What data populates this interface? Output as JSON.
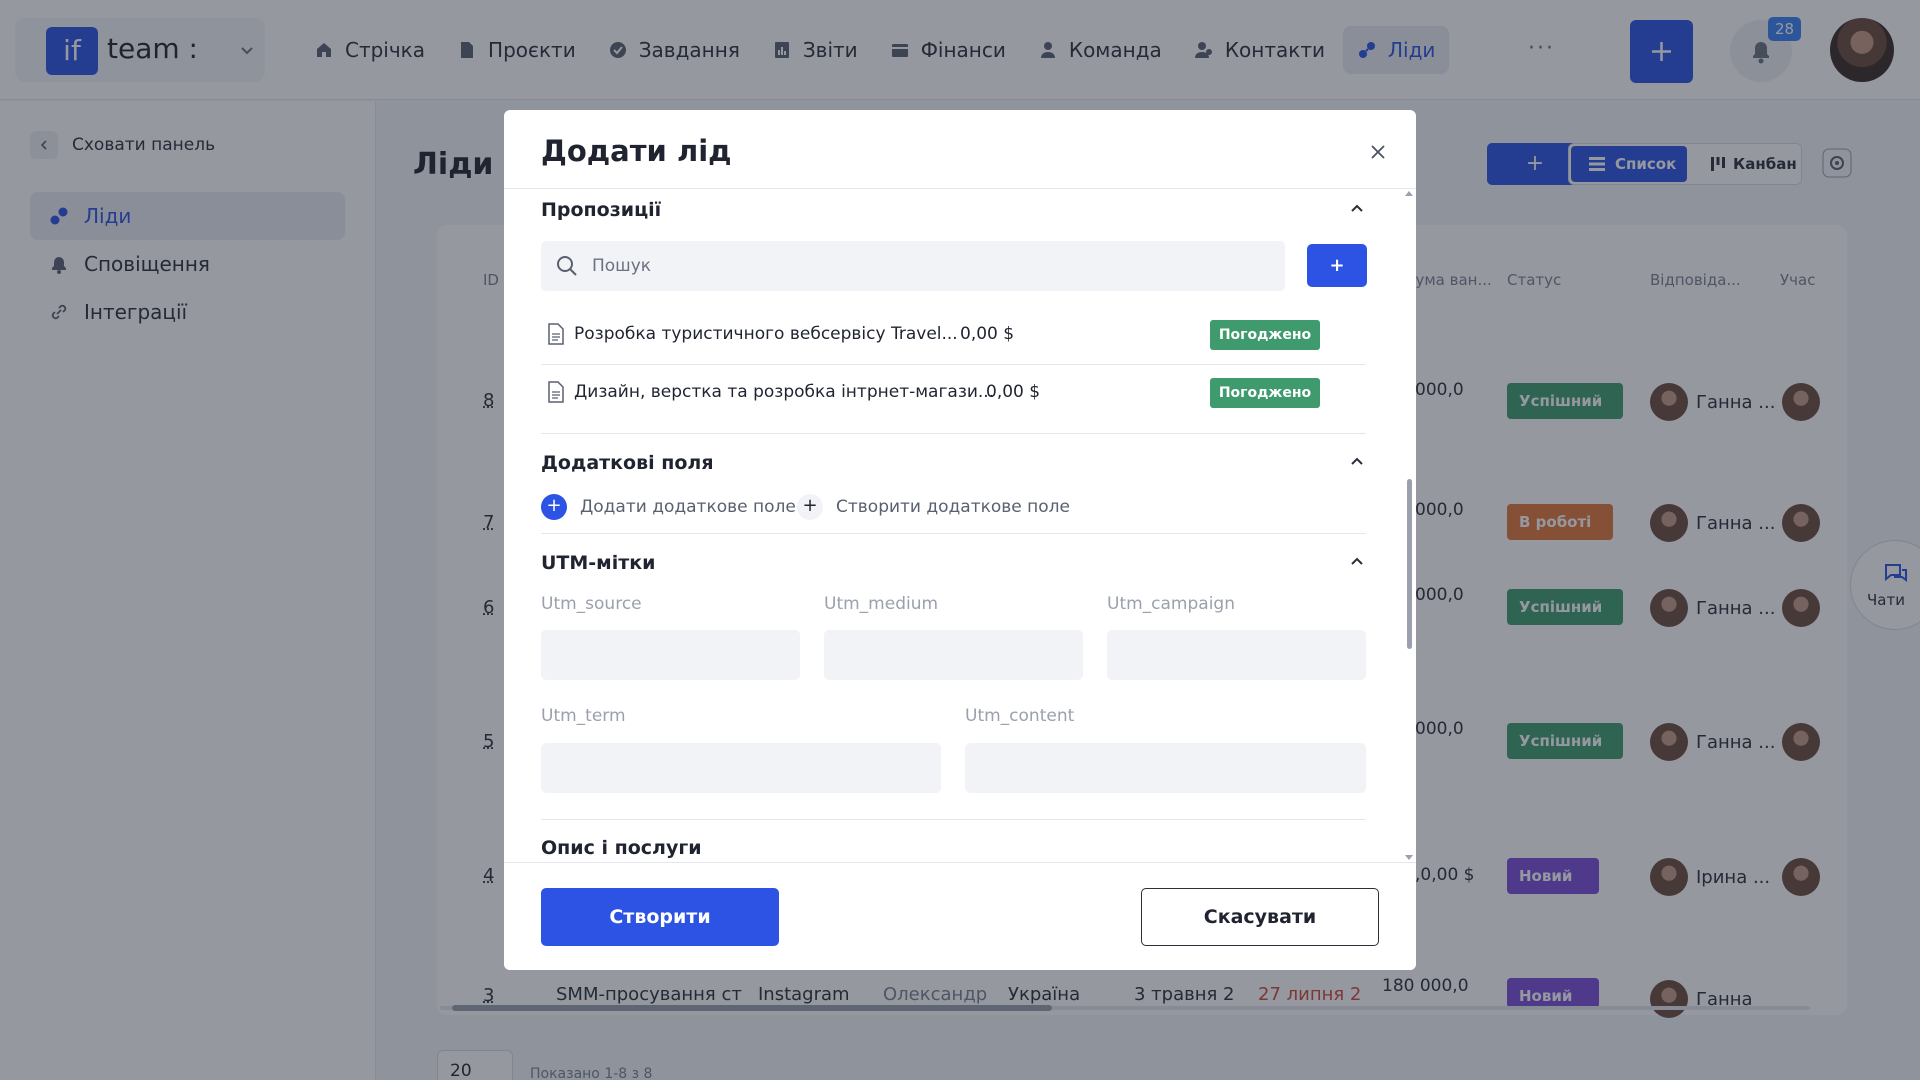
{
  "brand": {
    "logo": "if",
    "name": "team :"
  },
  "nav": {
    "items": [
      {
        "label": "Стрічка",
        "icon": "home-icon"
      },
      {
        "label": "Проєкти",
        "icon": "document-icon"
      },
      {
        "label": "Завдання",
        "icon": "check-circle-icon"
      },
      {
        "label": "Звіти",
        "icon": "report-icon"
      },
      {
        "label": "Фінанси",
        "icon": "wallet-icon"
      },
      {
        "label": "Команда",
        "icon": "person-icon"
      },
      {
        "label": "Контакти",
        "icon": "contacts-icon"
      },
      {
        "label": "Ліди",
        "icon": "leads-icon",
        "active": true
      }
    ],
    "more": "···",
    "notifications_count": "28"
  },
  "sidebar": {
    "hide_label": "Сховати панель",
    "items": [
      {
        "label": "Ліди",
        "active": true
      },
      {
        "label": "Сповіщення"
      },
      {
        "label": "Інтеграції"
      }
    ]
  },
  "page": {
    "title": "Ліди",
    "add_label": "+",
    "view_list": "Список",
    "view_kanban": "Канбан",
    "columns": {
      "id": "ID",
      "sum": "Сума ван...",
      "status": "Статус",
      "responsible": "Відповіда...",
      "participants": "Учас"
    },
    "rows": [
      {
        "id": "8",
        "sum": "000,0",
        "status": "Успішний",
        "responsible": "Ганна ..."
      },
      {
        "id": "7",
        "sum": "000,0",
        "status": "В роботі",
        "responsible": "Ганна ..."
      },
      {
        "id": "6",
        "sum": "000,0",
        "status": "Успішний",
        "responsible": "Ганна ..."
      },
      {
        "id": "5",
        "sum": "000,0",
        "status": "Успішний",
        "responsible": "Ганна ..."
      },
      {
        "id": "4",
        "sum": ",0,00 $",
        "status": "Новий",
        "responsible": "Ірина ..."
      },
      {
        "id": "3",
        "sum": "180 000,0",
        "status": "Новий",
        "responsible": "Ганна"
      }
    ],
    "bottom_row": {
      "name": "SMM-просування ст",
      "source": "Instagram",
      "person": "Олександр",
      "country": "Україна",
      "created": "3 травня 2",
      "deadline": "27 липня 2"
    },
    "page_size": "20",
    "shown": "Показано 1-8 з 8",
    "chat_label": "Чати"
  },
  "modal": {
    "title": "Додати лід",
    "proposals": {
      "title": "Пропозиції",
      "search_placeholder": "Пошук",
      "add_label": "+",
      "items": [
        {
          "name": "Розробка туристичного вебсервісу Travel...",
          "price": "0,00 $",
          "status": "Погоджено"
        },
        {
          "name": "Дизайн, верстка та розробка інтрнет-магази...",
          "price": "0,00 $",
          "status": "Погоджено"
        }
      ]
    },
    "extra_fields": {
      "title": "Додаткові поля",
      "add_label": "Додати додаткове поле",
      "create_label": "Створити додаткове поле"
    },
    "utm": {
      "title": "UTM-мітки",
      "source": "Utm_source",
      "medium": "Utm_medium",
      "campaign": "Utm_campaign",
      "term": "Utm_term",
      "content": "Utm_content"
    },
    "description": {
      "title": "Опис і послуги"
    },
    "create_label": "Створити",
    "cancel_label": "Скасувати"
  },
  "colors": {
    "primary": "#2c53e3",
    "success": "#3f9b6e",
    "warning": "#e0773a",
    "new": "#7c4dd8"
  }
}
